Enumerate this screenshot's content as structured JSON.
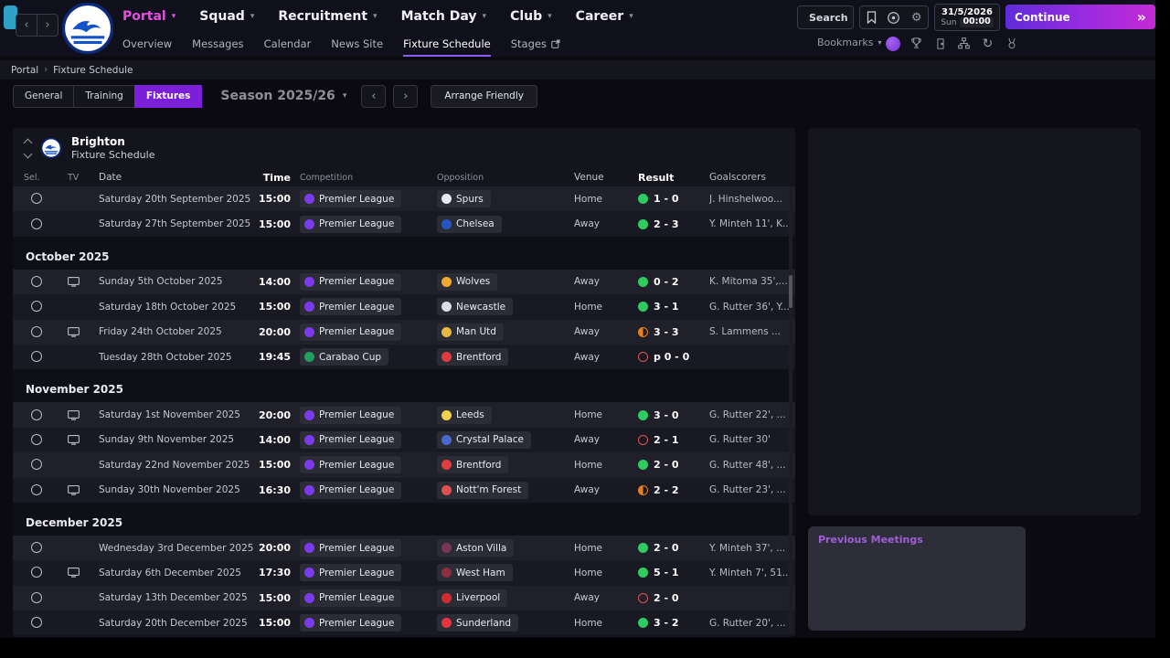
{
  "topbar": {
    "nav": [
      {
        "label": "Portal"
      },
      {
        "label": "Squad"
      },
      {
        "label": "Recruitment"
      },
      {
        "label": "Match Day"
      },
      {
        "label": "Club"
      },
      {
        "label": "Career"
      }
    ],
    "subnav": [
      {
        "label": "Overview"
      },
      {
        "label": "Messages"
      },
      {
        "label": "Calendar"
      },
      {
        "label": "News Site"
      },
      {
        "label": "Fixture Schedule"
      },
      {
        "label": "Stages"
      }
    ],
    "search_label": "Search",
    "date": "31/5/2026",
    "day": "Sun",
    "time": "00:00",
    "continue_label": "Continue",
    "continue_chevrons": "»",
    "bookmarks_label": "Bookmarks"
  },
  "breadcrumb": {
    "items": [
      "Portal",
      "Fixture Schedule"
    ]
  },
  "toolbar": {
    "tabs": [
      {
        "label": "General"
      },
      {
        "label": "Training"
      },
      {
        "label": "Fixtures"
      }
    ],
    "season_label": "Season 2025/26",
    "arrange_friendly_label": "Arrange Friendly"
  },
  "fixtures": {
    "club": "Brighton",
    "title": "Fixture Schedule",
    "columns": [
      "Sel.",
      "TV",
      "Date",
      "Time",
      "Competition",
      "Opposition",
      "Venue",
      "Result",
      "Goalscorers"
    ],
    "rows": [
      {
        "type": "fixture",
        "tv": false,
        "date": "Saturday 20th September 2025",
        "time": "15:00",
        "competition": "Premier League",
        "comp_color": "#7c3aed",
        "opposition": "Spurs",
        "opp_color": "#e6ebf2",
        "venue": "Home",
        "result": "1 - 0",
        "outcome": "win",
        "goalscorers": "J. Hinshelwoo..."
      },
      {
        "type": "fixture",
        "tv": false,
        "date": "Saturday 27th September 2025",
        "time": "15:00",
        "competition": "Premier League",
        "comp_color": "#7c3aed",
        "opposition": "Chelsea",
        "opp_color": "#2456c4",
        "venue": "Away",
        "result": "2 - 3",
        "outcome": "win",
        "goalscorers": "Y. Minteh 11', K..."
      },
      {
        "type": "month",
        "label": "October 2025"
      },
      {
        "type": "fixture",
        "tv": true,
        "date": "Sunday 5th October 2025",
        "time": "14:00",
        "competition": "Premier League",
        "comp_color": "#7c3aed",
        "opposition": "Wolves",
        "opp_color": "#f0a92e",
        "venue": "Away",
        "result": "0 - 2",
        "outcome": "win",
        "goalscorers": "K. Mitoma 35',..."
      },
      {
        "type": "fixture",
        "tv": false,
        "date": "Saturday 18th October 2025",
        "time": "15:00",
        "competition": "Premier League",
        "comp_color": "#7c3aed",
        "opposition": "Newcastle",
        "opp_color": "#d9dee6",
        "venue": "Home",
        "result": "3 - 1",
        "outcome": "win",
        "goalscorers": "G. Rutter 36', Y..."
      },
      {
        "type": "fixture",
        "tv": true,
        "date": "Friday 24th October 2025",
        "time": "20:00",
        "competition": "Premier League",
        "comp_color": "#7c3aed",
        "opposition": "Man Utd",
        "opp_color": "#e8b93e",
        "venue": "Away",
        "result": "3 - 3",
        "outcome": "draw",
        "goalscorers": "S. Lammens ..."
      },
      {
        "type": "fixture",
        "tv": false,
        "date": "Tuesday 28th October 2025",
        "time": "19:45",
        "competition": "Carabao Cup",
        "comp_color": "#1fa05d",
        "opposition": "Brentford",
        "opp_color": "#e23b3b",
        "venue": "Away",
        "result": "p 0 - 0",
        "outcome": "loss",
        "goalscorers": ""
      },
      {
        "type": "month",
        "label": "November 2025"
      },
      {
        "type": "fixture",
        "tv": true,
        "date": "Saturday 1st November 2025",
        "time": "20:00",
        "competition": "Premier League",
        "comp_color": "#7c3aed",
        "opposition": "Leeds",
        "opp_color": "#f3d14b",
        "venue": "Home",
        "result": "3 - 0",
        "outcome": "win",
        "goalscorers": "G. Rutter 22', ..."
      },
      {
        "type": "fixture",
        "tv": true,
        "date": "Sunday 9th November 2025",
        "time": "14:00",
        "competition": "Premier League",
        "comp_color": "#7c3aed",
        "opposition": "Crystal Palace",
        "opp_color": "#4a68d0",
        "venue": "Away",
        "result": "2 - 1",
        "outcome": "loss",
        "goalscorers": "G. Rutter 30'"
      },
      {
        "type": "fixture",
        "tv": false,
        "date": "Saturday 22nd November 2025",
        "time": "15:00",
        "competition": "Premier League",
        "comp_color": "#7c3aed",
        "opposition": "Brentford",
        "opp_color": "#e23b3b",
        "venue": "Home",
        "result": "2 - 0",
        "outcome": "win",
        "goalscorers": "G. Rutter 48', ..."
      },
      {
        "type": "fixture",
        "tv": true,
        "date": "Sunday 30th November 2025",
        "time": "16:30",
        "competition": "Premier League",
        "comp_color": "#7c3aed",
        "opposition": "Nott'm Forest",
        "opp_color": "#e05050",
        "venue": "Away",
        "result": "2 - 2",
        "outcome": "draw",
        "goalscorers": "G. Rutter 23', ..."
      },
      {
        "type": "month",
        "label": "December 2025"
      },
      {
        "type": "fixture",
        "tv": false,
        "date": "Wednesday 3rd December 2025",
        "time": "20:00",
        "competition": "Premier League",
        "comp_color": "#7c3aed",
        "opposition": "Aston Villa",
        "opp_color": "#7a3558",
        "venue": "Home",
        "result": "2 - 0",
        "outcome": "win",
        "goalscorers": "Y. Minteh 37', ..."
      },
      {
        "type": "fixture",
        "tv": true,
        "date": "Saturday 6th December 2025",
        "time": "17:30",
        "competition": "Premier League",
        "comp_color": "#7c3aed",
        "opposition": "West Ham",
        "opp_color": "#8a2f42",
        "venue": "Home",
        "result": "5 - 1",
        "outcome": "win",
        "goalscorers": "Y. Minteh 7', 51..."
      },
      {
        "type": "fixture",
        "tv": false,
        "date": "Saturday 13th December 2025",
        "time": "15:00",
        "competition": "Premier League",
        "comp_color": "#7c3aed",
        "opposition": "Liverpool",
        "opp_color": "#d42c2c",
        "venue": "Away",
        "result": "2 - 0",
        "outcome": "loss",
        "goalscorers": ""
      },
      {
        "type": "fixture",
        "tv": false,
        "date": "Saturday 20th December 2025",
        "time": "15:00",
        "competition": "Premier League",
        "comp_color": "#7c3aed",
        "opposition": "Sunderland",
        "opp_color": "#e8343c",
        "venue": "Home",
        "result": "3 - 2",
        "outcome": "win",
        "goalscorers": "G. Rutter 20', ..."
      }
    ]
  },
  "side": {
    "previous_meetings_label": "Previous Meetings"
  },
  "colors": {
    "accent_purple": "#7c1fd9",
    "portal_pink": "#e44fe0",
    "win": "#2ecc5e",
    "draw": "#e67e22",
    "loss": "#e05252",
    "continue_gradient_start": "#5f2bd9",
    "continue_gradient_end": "#c32bd4"
  }
}
